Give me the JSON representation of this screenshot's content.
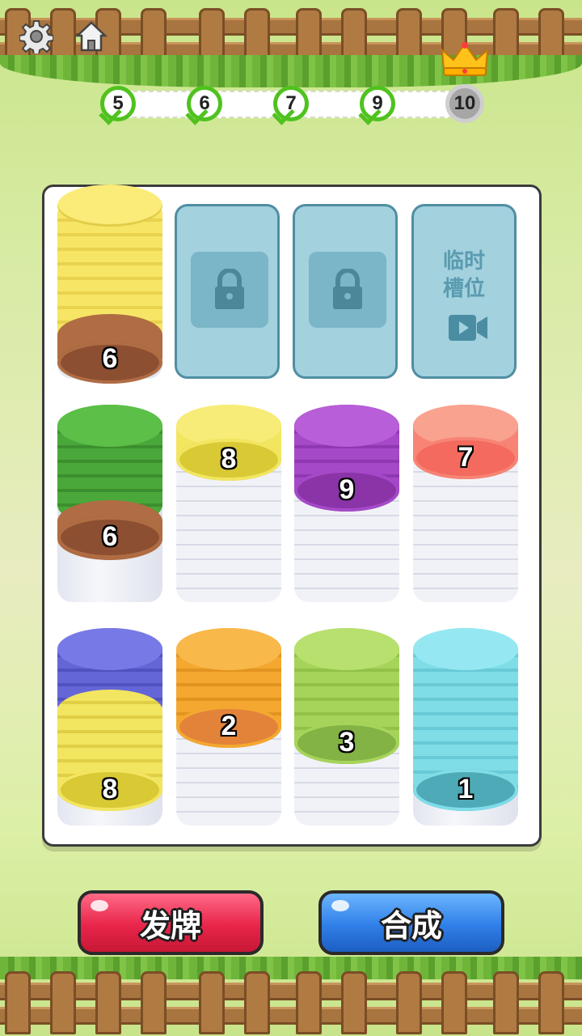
{
  "header": {
    "icons": [
      "gear-icon",
      "home-icon"
    ]
  },
  "progress": {
    "steps": [
      {
        "label": "5",
        "state": "done"
      },
      {
        "label": "6",
        "state": "done"
      },
      {
        "label": "7",
        "state": "done"
      },
      {
        "label": "9",
        "state": "done"
      },
      {
        "label": "10",
        "state": "current"
      }
    ]
  },
  "board": {
    "tubes": [
      {
        "row": 0,
        "col": 0,
        "label": "6",
        "colors": {
          "top": "#f7e565",
          "base": "#9a5a3a"
        }
      },
      {
        "row": 1,
        "col": 0,
        "label": "6",
        "colors": {
          "top": "#4aa83a",
          "base": "#9a5a3a"
        }
      },
      {
        "row": 1,
        "col": 1,
        "label": "8",
        "colors": {
          "top": "#f2e560"
        }
      },
      {
        "row": 1,
        "col": 2,
        "label": "9",
        "colors": {
          "top": "#a549c8"
        }
      },
      {
        "row": 1,
        "col": 3,
        "label": "7",
        "colors": {
          "top": "#f78474"
        }
      },
      {
        "row": 2,
        "col": 0,
        "label": "8",
        "colors": {
          "top": "#6466d8",
          "base": "#f2e560"
        }
      },
      {
        "row": 2,
        "col": 1,
        "label": "2",
        "colors": {
          "top": "#f4a830"
        }
      },
      {
        "row": 2,
        "col": 2,
        "label": "3",
        "colors": {
          "top": "#a6d45a"
        }
      },
      {
        "row": 2,
        "col": 3,
        "label": "1",
        "colors": {
          "top": "#7fdde8"
        }
      }
    ],
    "locked_slots": 2,
    "temp_slot": {
      "line1": "临时",
      "line2": "槽位"
    }
  },
  "buttons": {
    "deal": "发牌",
    "merge": "合成"
  },
  "colors": {
    "accent_green": "#4fc21e",
    "deal_red": "#e8254a",
    "merge_blue": "#2f7fe8"
  }
}
